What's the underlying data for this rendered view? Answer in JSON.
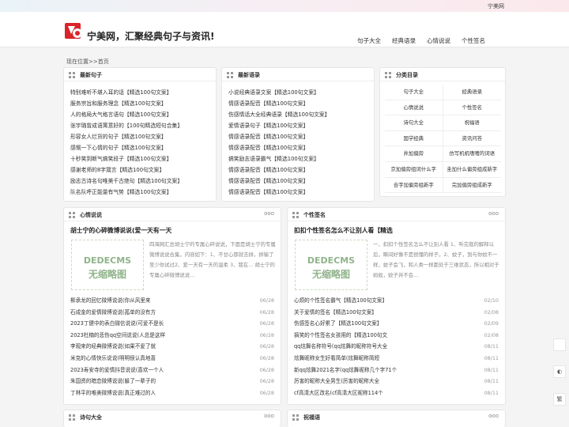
{
  "topbar": {
    "site_link": "宁美网"
  },
  "header": {
    "site_title": "宁美网，汇聚经典句子与资讯!",
    "nav": [
      "句子大全",
      "经典语录",
      "心情说说",
      "个性签名"
    ]
  },
  "breadcrumb": "现在位置>>首页",
  "latest_sentences": {
    "title": "最新句子",
    "items": [
      "特别难听不堪入耳的话【精选100句文案】",
      "服务宗旨和服务理念【精选100句文案】",
      "人的格局大气格言语句【精选100句文案】",
      "张宇璐曾成语寓意好的【100句精选短句合集】",
      "形容女人烂货的句子【精选100句文案】",
      "感慨一下心情的句子【精选100句文案】",
      "十秒笑到断气搞笑段子【精选100句文案】",
      "感谢老师的8字箴言【精选100句文案】",
      "励志古诗名句唯美千古绝句【精选100句文案】",
      "队名队呼正能量有气势【精选100句文案】"
    ]
  },
  "latest_quotes": {
    "title": "最新语录",
    "items": [
      "小说经典语录文案【精选100句文案】",
      "情感语录配音【精选100句文案】",
      "伤感情话大全经典语录【精选100句文案】",
      "爱情语录句子【精选100句文案】",
      "情感语录配音【精选100句文案】",
      "情感语录配音【精选100句文案】",
      "搞笑励志语录霸气【精选100句文案】",
      "情感语录配音【精选100句文案】",
      "情感语录配音【精选100句文案】",
      "情感语录配音【精选100句文案】"
    ]
  },
  "categories": {
    "title": "分类目录",
    "items": [
      "句子大全",
      "经典语录",
      "心情说说",
      "个性签名",
      "诗句大全",
      "祝福语",
      "国学经典",
      "资讯问答",
      "井加偏旁",
      "仿写机机嗜嗜的词语",
      "京加偏旁组词什么字",
      "圭加什么偏旁组成新字",
      "合字加偏旁组新字",
      "完加偏旁组成新字"
    ]
  },
  "mood_section": {
    "title": "心情说说",
    "more": "ooo",
    "featured_title": "胡士宁的心碎微博说说(爱一天有一天",
    "thumb_line1": "DEDECMS",
    "thumb_line2": "无缩略图",
    "excerpt": "四海网汇总胡士宁的专属心碎说说，下面是胡士宁的专属微博说说合集，内容如下：1、不甘心那就去拼，拼输了至少你试过2、爱一天有一天的温柔 3、我在... 胡士宁的专属心碎微博说说...",
    "rows": [
      {
        "title": "柳承龙的回忆微博说说(你从风里来",
        "date": "06/28"
      },
      {
        "title": "石成金的爱情微博说说(孤单的没有方",
        "date": "06/28"
      },
      {
        "title": "2023丁健中的表白微信说说(可爱不是长",
        "date": "06/28"
      },
      {
        "title": "2023杜楠的悲伤qq空间说说(人总是这样",
        "date": "06/28"
      },
      {
        "title": "李观来的经典微博说说(如果不爱了就",
        "date": "06/28"
      },
      {
        "title": "米克的心情快乐说说(明明很认真地喜",
        "date": "06/28"
      },
      {
        "title": "2023寿安寺的爱情抖音说说(喜欢一个人",
        "date": "06/28"
      },
      {
        "title": "朱国资的暗恋微博说说(躲了一辈子的",
        "date": "06/28"
      },
      {
        "title": "丁林平的唯美微博说说(真正难过的人",
        "date": "06/28"
      }
    ]
  },
  "signature_section": {
    "title": "个性签名",
    "more": "ooo",
    "featured_title": "扣扣个性签名怎么不让别人看【精选",
    "thumb_line1": "DEDECMS",
    "thumb_line2": "无缩略图",
    "excerpt": "一、扣扣个性签名怎么不让别人看 1、听完我的解释以后，瞬间好像不是很懂的样子。2、蚊子，到与你蚊不一样，蚊子会飞，和人类一样都处于三维状态，所以相对于蚂蚁，蚊子并不会...",
    "rows": [
      {
        "title": "心烦的个性签名霸气【精选100句文案】",
        "date": "02/10"
      },
      {
        "title": "关于爱情的签名【精选100句文案】",
        "date": "02/08"
      },
      {
        "title": "伤感签名心好累了【精选100句文案】",
        "date": "02/09"
      },
      {
        "title": "搞笑的个性签名女孩用的【精选100句文",
        "date": "02/08"
      },
      {
        "title": "qq炫舞名称符号(qq炫舞的昵称符号大全",
        "date": "08/11"
      },
      {
        "title": "炫舞昵称女生好看简单(炫舞昵称简短",
        "date": "08/11"
      },
      {
        "title": "新qq炫舞2021名字(qq炫舞昵称几个字71个",
        "date": "08/11"
      },
      {
        "title": "厉害的昵称大全男生(厉害的昵称大全",
        "date": "08/11"
      },
      {
        "title": "cf高清大区改名(cf高清大区昵称114个",
        "date": "08/11"
      }
    ]
  },
  "poems_section": {
    "title": "诗句大全",
    "more": "ooo"
  },
  "blessing_section": {
    "title": "祝福语",
    "more": "ooo"
  },
  "side_tools": [
    "◐",
    "繁"
  ],
  "colors": {
    "accent_red": "#d9252a",
    "thumb_green": "#8fb38a"
  }
}
